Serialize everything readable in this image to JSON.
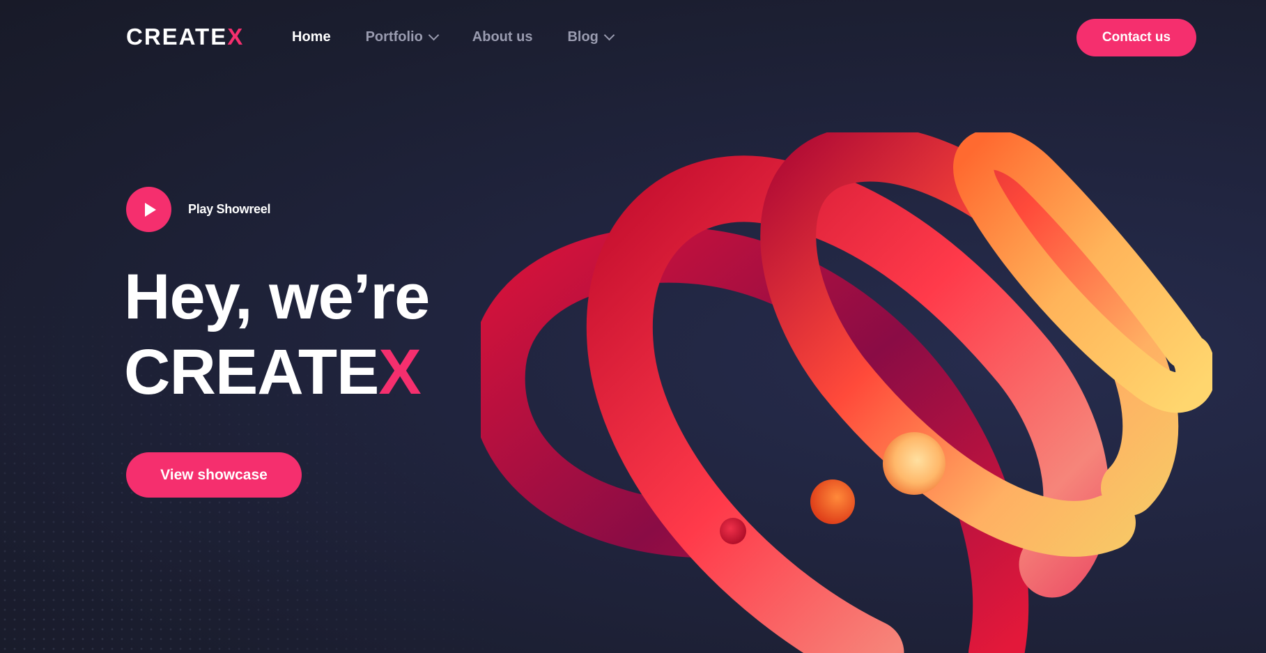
{
  "brand": {
    "logo_main": "CREATE",
    "logo_accent": "X",
    "accent_color": "#f52f6e",
    "background_color": "#1e2235"
  },
  "nav": {
    "items": [
      {
        "label": "Home",
        "active": true,
        "has_dropdown": false
      },
      {
        "label": "Portfolio",
        "active": false,
        "has_dropdown": true
      },
      {
        "label": "About us",
        "active": false,
        "has_dropdown": false
      },
      {
        "label": "Blog",
        "active": false,
        "has_dropdown": true
      }
    ],
    "contact_label": "Contact us"
  },
  "hero": {
    "play_label": "Play Showreel",
    "play_icon": "play-icon",
    "title_line1": "Hey, we’re",
    "title_line2_main": "CREATE",
    "title_line2_accent": "X",
    "cta_label": "View showcase"
  },
  "art": {
    "description_icon": "spiral-3d-illustration",
    "colors": [
      "#7a0a3e",
      "#e8163a",
      "#ff7a3d",
      "#f9c46a"
    ]
  }
}
